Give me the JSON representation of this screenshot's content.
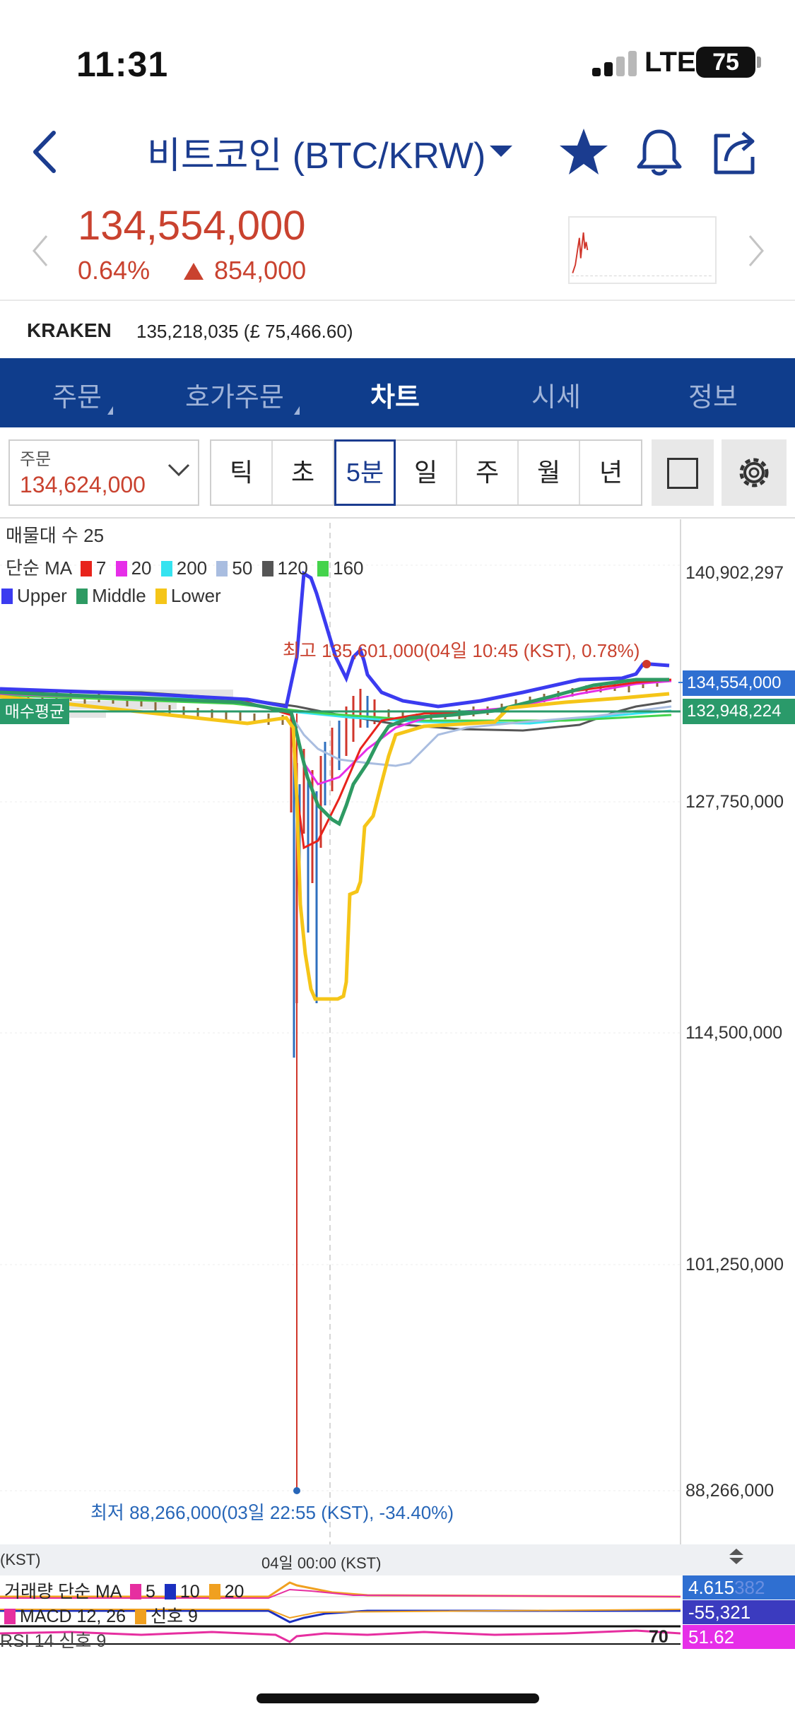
{
  "status_bar": {
    "time": "11:31",
    "network": "LTE",
    "battery": "75"
  },
  "header": {
    "title": "비트코인 (BTC/KRW)",
    "icons": [
      "back-icon",
      "star-icon",
      "bell-icon",
      "share-icon"
    ]
  },
  "price": {
    "current": "134,554,000",
    "change_pct": "0.64%",
    "change_amount": "854,000"
  },
  "exchange": {
    "name": "KRAKEN",
    "value": "135,218,035 (£ 75,466.60)"
  },
  "tabs": [
    "주문",
    "호가주문",
    "차트",
    "시세",
    "정보"
  ],
  "active_tab": "차트",
  "order": {
    "label": "주문",
    "value": "134,624,000"
  },
  "periods": [
    "틱",
    "초",
    "5분",
    "일",
    "주",
    "월",
    "년"
  ],
  "active_period": "5분",
  "legend": {
    "volume_profile": "매물대 수 25",
    "ma_label": "단순 MA",
    "ma_items": [
      {
        "label": "7",
        "color": "#e8231b"
      },
      {
        "label": "20",
        "color": "#e62ee8"
      },
      {
        "label": "200",
        "color": "#35e3f0"
      },
      {
        "label": "50",
        "color": "#a9bde0"
      },
      {
        "label": "120",
        "color": "#555555"
      },
      {
        "label": "160",
        "color": "#45d34c"
      }
    ],
    "bb_items": [
      {
        "label": "Upper",
        "color": "#3b3bf0"
      },
      {
        "label": "Middle",
        "color": "#2e9a63"
      },
      {
        "label": "Lower",
        "color": "#f5c518"
      }
    ]
  },
  "chart_data": {
    "type": "candlestick",
    "y_ticks": [
      "140,902,297",
      "127,750,000",
      "114,500,000",
      "101,250,000",
      "88,266,000"
    ],
    "current_price_tag": "134,554,000",
    "avg_buy_tag": "132,948,224",
    "avg_buy_label": "매수평균",
    "high_annotation": "최고 135,601,000(04일 10:45 (KST), 0.78%)",
    "low_annotation": "최저 88,266,000(03일 22:55 (KST), -34.40%)",
    "x_labels": [
      "(KST)",
      "04일 00:00 (KST)"
    ],
    "high": 135601000,
    "low": 88266000,
    "ylim": [
      88266000,
      140902297
    ]
  },
  "indicators": {
    "volume": {
      "label": "거래량 단순 MA",
      "ma": [
        {
          "label": "5",
          "color": "#e62ea0"
        },
        {
          "label": "10",
          "color": "#1b2fbf"
        },
        {
          "label": "20",
          "color": "#f0a020"
        }
      ],
      "value": "4.615",
      "value_overlap": "382"
    },
    "macd": {
      "label": "MACD 12, 26",
      "signal": "신호 9",
      "value": "-55,321",
      "macd_color": "#e62ea0",
      "signal_color": "#f0a020"
    },
    "rsi": {
      "label": "RSI 14 신호 9",
      "value": "51.62",
      "level": "70"
    }
  },
  "colors": {
    "up": "#c9422f",
    "brand": "#0f3d8c",
    "accent": "#1b3c8f"
  }
}
